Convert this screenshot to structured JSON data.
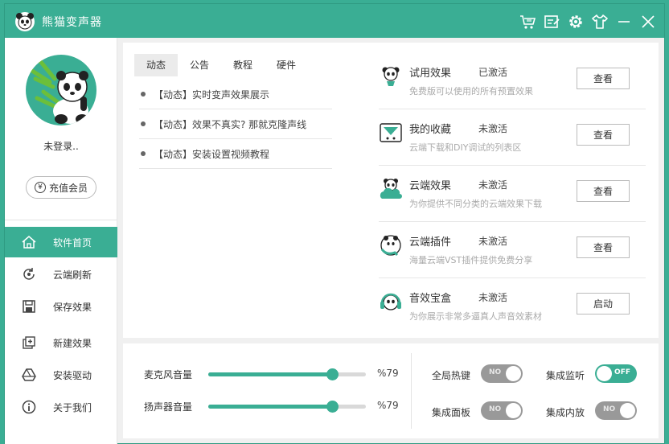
{
  "app": {
    "title": "熊猫变声器"
  },
  "titlebar": {
    "icons": [
      "cart-icon",
      "edit-icon",
      "gear-icon",
      "shirt-icon",
      "minimize-icon",
      "close-icon"
    ]
  },
  "user": {
    "login_text": "未登录..",
    "vip_button": "充值会员"
  },
  "nav": [
    {
      "label": "软件首页",
      "icon": "home-icon",
      "active": true
    },
    {
      "label": "云端刷新",
      "icon": "refresh-icon"
    },
    {
      "label": "保存效果",
      "icon": "save-icon"
    },
    {
      "label": "新建效果",
      "icon": "new-icon"
    },
    {
      "label": "安装驱动",
      "icon": "drive-icon"
    },
    {
      "label": "关于我们",
      "icon": "info-icon"
    }
  ],
  "tabs": [
    "动态",
    "公告",
    "教程",
    "硬件"
  ],
  "news": [
    "【动态】实时变声效果展示",
    "【动态】效果不真实? 那就克隆声线",
    "【动态】安装设置视频教程"
  ],
  "features": [
    {
      "name": "试用效果",
      "status": "已激活",
      "desc": "免费版可以使用的所有预置效果",
      "button": "查看",
      "icon": "panda-trial-icon"
    },
    {
      "name": "我的收藏",
      "status": "未激活",
      "desc": "云端下载和DIY调试的列表区",
      "button": "查看",
      "icon": "favorite-icon"
    },
    {
      "name": "云端效果",
      "status": "未激活",
      "desc": "为你提供不同分类的云端效果下载",
      "button": "查看",
      "icon": "cloud-icon"
    },
    {
      "name": "云端插件",
      "status": "未激活",
      "desc": "海量云端VST插件提供免费分享",
      "button": "查看",
      "icon": "plugin-icon"
    },
    {
      "name": "音效宝盒",
      "status": "未激活",
      "desc": "为你展示非常多逼真人声音效素材",
      "button": "启动",
      "icon": "headphones-icon"
    }
  ],
  "sliders": [
    {
      "label": "麦克风音量",
      "value": 79,
      "display": "%79"
    },
    {
      "label": "扬声器音量",
      "value": 79,
      "display": "%79"
    }
  ],
  "toggles": [
    {
      "label": "全局热键",
      "state": "NO",
      "on": false
    },
    {
      "label": "集成监听",
      "state": "OFF",
      "on": true
    },
    {
      "label": "集成面板",
      "state": "NO",
      "on": false
    },
    {
      "label": "集成内放",
      "state": "NO",
      "on": false
    }
  ],
  "colors": {
    "accent": "#3aae94",
    "toggle_off": "#999999"
  }
}
